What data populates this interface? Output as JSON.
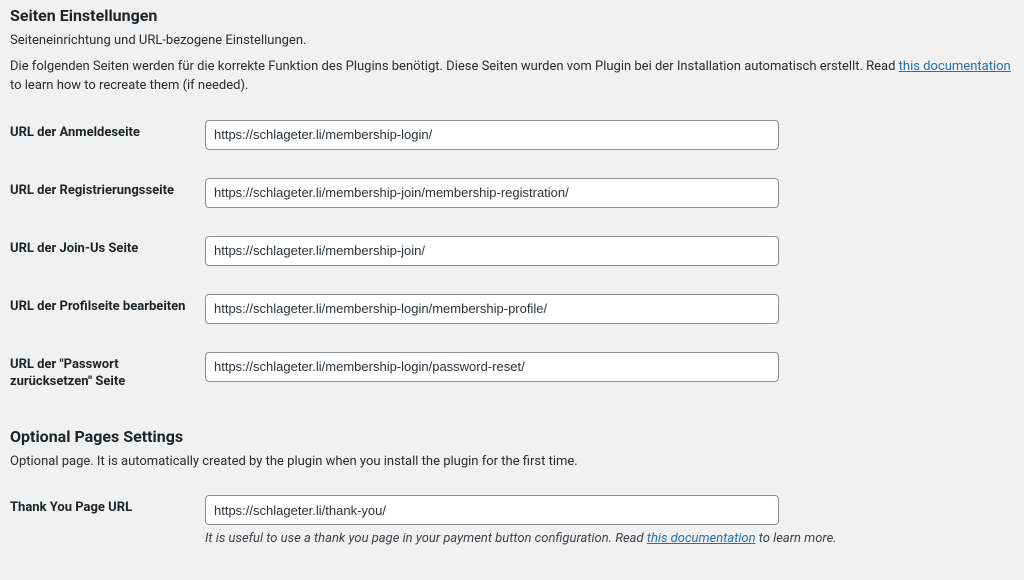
{
  "section1": {
    "title": "Seiten Einstellungen",
    "subtitle": "Seiteneinrichtung und URL-bezogene Einstellungen.",
    "intro_before": "Die folgenden Seiten werden für die korrekte Funktion des Plugins benötigt. Diese Seiten wurden vom Plugin bei der Installation automatisch erstellt. Read ",
    "intro_link": "this documentation",
    "intro_after": " to learn how to recreate them (if needed)."
  },
  "fields": {
    "login": {
      "label": "URL der Anmeldeseite",
      "value": "https://schlageter.li/membership-login/"
    },
    "reg": {
      "label": "URL der Registrierungsseite",
      "value": "https://schlageter.li/membership-join/membership-registration/"
    },
    "joinus": {
      "label": "URL der Join-Us Seite",
      "value": "https://schlageter.li/membership-join/"
    },
    "profile": {
      "label": "URL der Profilseite bearbeiten",
      "value": "https://schlageter.li/membership-login/membership-profile/"
    },
    "reset": {
      "label": "URL der \"Passwort zurücksetzen\" Seite",
      "value": "https://schlageter.li/membership-login/password-reset/"
    }
  },
  "section2": {
    "title": "Optional Pages Settings",
    "subtitle": "Optional page. It is automatically created by the plugin when you install the plugin for the first time."
  },
  "thankyou": {
    "label": "Thank You Page URL",
    "value": "https://schlageter.li/thank-you/",
    "help_before": "It is useful to use a thank you page in your payment button configuration. Read ",
    "help_link": "this documentation",
    "help_after": " to learn more."
  }
}
